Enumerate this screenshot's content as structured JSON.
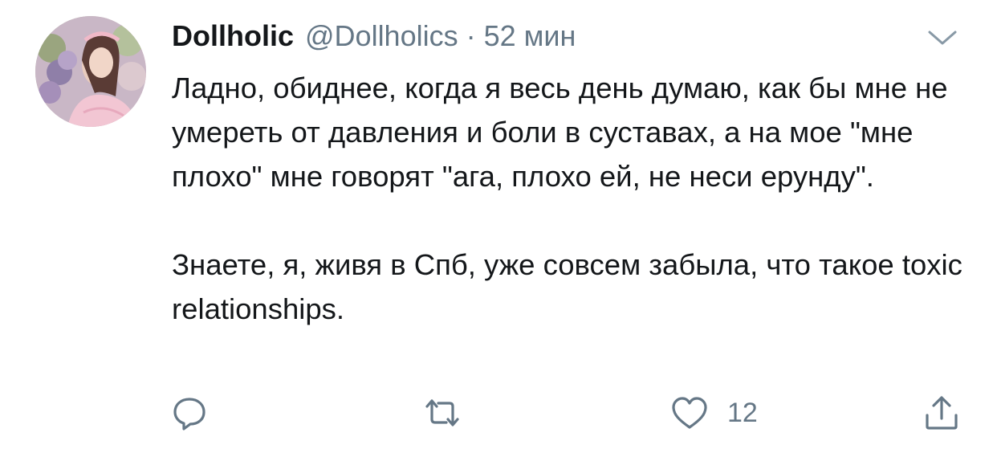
{
  "tweet": {
    "author": {
      "display_name": "Dollholic",
      "handle": "@Dollholics"
    },
    "separator": "·",
    "time": "52 мин",
    "text": {
      "paragraph_1": "Ладно, обиднее, когда я весь день думаю, как бы мне не умереть от давления и боли в суставах, а на мое \"мне плохо\" мне говорят \"ага, плохо ей, не неси ерунду\".",
      "paragraph_2": "Знаете, я, живя в Спб, уже совсем забыла, что такое toxic relationships."
    },
    "actions": {
      "like_count": "12"
    },
    "icons": {
      "reply": "reply-icon",
      "retweet": "retweet-icon",
      "like": "heart-icon",
      "share": "share-icon",
      "menu": "chevron-down-icon"
    },
    "colors": {
      "text": "#14171a",
      "secondary": "#657786"
    }
  }
}
